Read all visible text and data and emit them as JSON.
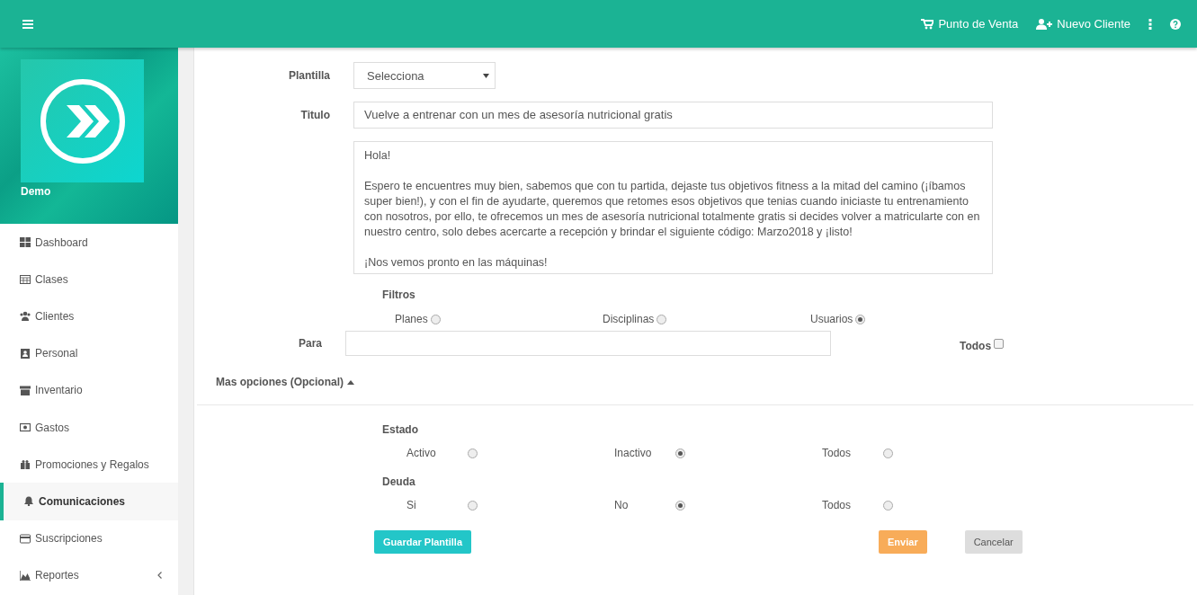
{
  "topbar": {
    "actions": [
      {
        "label": "Punto de Venta"
      },
      {
        "label": "Nuevo Cliente"
      }
    ]
  },
  "sidebar": {
    "brand": "Demo",
    "items": [
      {
        "label": "Dashboard",
        "selected": false,
        "submenu": false
      },
      {
        "label": "Clases",
        "selected": false,
        "submenu": false
      },
      {
        "label": "Clientes",
        "selected": false,
        "submenu": false
      },
      {
        "label": "Personal",
        "selected": false,
        "submenu": false
      },
      {
        "label": "Inventario",
        "selected": false,
        "submenu": false
      },
      {
        "label": "Gastos",
        "selected": false,
        "submenu": false
      },
      {
        "label": "Promociones y Regalos",
        "selected": false,
        "submenu": false
      },
      {
        "label": "Comunicaciones",
        "selected": true,
        "submenu": false
      },
      {
        "label": "Suscripciones",
        "selected": false,
        "submenu": false
      },
      {
        "label": "Reportes",
        "selected": false,
        "submenu": true
      }
    ]
  },
  "form": {
    "plantilla": {
      "label": "Plantilla",
      "value": "Selecciona"
    },
    "titulo": {
      "label": "Titulo",
      "value": "Vuelve a entrenar con un mes de asesoría nutricional gratis"
    },
    "message": {
      "value": "Hola!\n\nEspero te encuentres muy bien, sabemos que con tu partida, dejaste tus objetivos fitness a la mitad del camino (¡íbamos super bien!), y con el fin de ayudarte, queremos que retomes esos objetivos que tenias cuando iniciaste tu entrenamiento con nosotros, por ello, te ofrecemos un mes de asesoría nutricional totalmente gratis si decides volver a matricularte con en nuestro centro, solo debes acercarte a recepción y brindar el siguiente código: Marzo2018 y ¡listo!\n\n¡Nos vemos pronto en las máquinas!"
    },
    "filtros": {
      "label": "Filtros",
      "options": [
        {
          "label": "Planes",
          "selected": false
        },
        {
          "label": "Disciplinas",
          "selected": false
        },
        {
          "label": "Usuarios",
          "selected": true
        }
      ]
    },
    "para": {
      "label": "Para"
    },
    "todos": {
      "label": "Todos",
      "checked": false
    },
    "more_options": {
      "label": "Mas opciones (Opcional)",
      "expanded": true
    },
    "groups": [
      {
        "label": "Estado",
        "options": [
          {
            "label": "Activo",
            "selected": false
          },
          {
            "label": "Inactivo",
            "selected": true
          },
          {
            "label": "Todos",
            "selected": false
          }
        ]
      },
      {
        "label": "Deuda",
        "options": [
          {
            "label": "Si",
            "selected": false
          },
          {
            "label": "No",
            "selected": true
          },
          {
            "label": "Todos",
            "selected": false
          }
        ]
      }
    ],
    "buttons": [
      {
        "label": "Guardar Plantilla",
        "kind": "primary"
      },
      {
        "label": "Enviar",
        "kind": "warning"
      },
      {
        "label": "Cancelar",
        "kind": "default"
      }
    ]
  }
}
